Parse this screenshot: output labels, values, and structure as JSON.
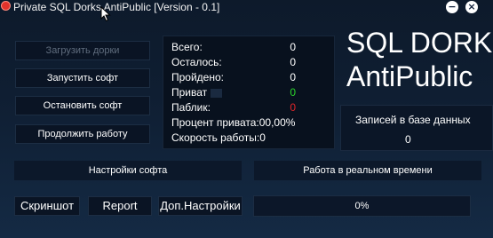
{
  "window": {
    "title": "Private SQL Dorks AntiPublic [Version - 0.1]",
    "minimize_glyph": "−",
    "close_glyph": "×"
  },
  "buttons": {
    "load_dorks": "Загрузить дорки",
    "start": "Запустить софт",
    "stop": "Остановить софт",
    "continue": "Продолжить работу",
    "screenshot": "Скриншот",
    "report": "Report",
    "extra_settings": "Доп.Настройки"
  },
  "stats": {
    "total_label": "Всего:",
    "total_value": "0",
    "remaining_label": "Осталось:",
    "remaining_value": "0",
    "passed_label": "Пройдено:",
    "passed_value": "0",
    "private_label": "Приват",
    "private_value": "0",
    "public_label": "Паблик:",
    "public_value": "0",
    "private_percent": "Процент привата:00,00%",
    "speed": "Скорость работы:0"
  },
  "brand": {
    "line1": "SQL DORKS",
    "line2": "AntiPublic"
  },
  "records": {
    "label": "Записей в базе данных",
    "value": "0"
  },
  "sections": {
    "settings": "Настройки софта",
    "realtime": "Работа в реальном времени"
  },
  "progress": {
    "value": 0,
    "text": "0%"
  },
  "colors": {
    "private_value": "#2bd42b",
    "public_value": "#e0262a",
    "disabled_text": "#5f6c7d",
    "background": "#0f1e32"
  },
  "icons": {
    "app": "app-icon",
    "minimize": "minimize-icon",
    "close": "close-icon",
    "cursor": "cursor-icon"
  }
}
